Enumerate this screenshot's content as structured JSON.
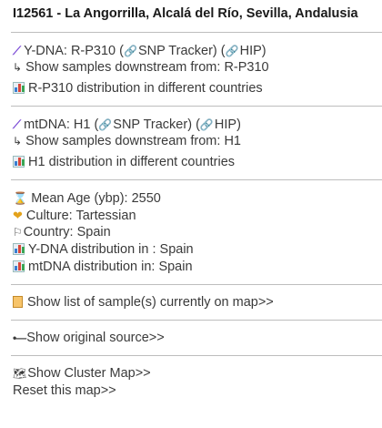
{
  "title": "I12561 - La Angorrilla, Alcalá del Río, Sevilla, Andalusia",
  "ydna": {
    "label": "Y-DNA: R-P310 (",
    "snp": "SNP Tracker",
    "mid": ") (",
    "hip": "HIP",
    "end": ")",
    "downstream": "Show samples downstream from: R-P310",
    "distribution": "R-P310 distribution in different countries"
  },
  "mtdna": {
    "label": "mtDNA: H1 (",
    "snp": "SNP Tracker",
    "mid": ") (",
    "hip": "HIP",
    "end": ")",
    "downstream": "Show samples downstream from: H1",
    "distribution": "H1 distribution in different countries"
  },
  "info": {
    "mean_age": "Mean Age (ybp): 2550",
    "culture": "Culture: Tartessian",
    "country": "Country: Spain",
    "ydna_dist": "Y-DNA distribution in : Spain",
    "mtdna_dist": "mtDNA distribution in: Spain"
  },
  "links": {
    "sample_list": "Show list of sample(s) currently on map>>",
    "original_source": "Show original source>>",
    "cluster_map": "Show Cluster Map>>",
    "reset": "Reset this map>>"
  },
  "icons": {
    "dna": "dna-icon",
    "arrow": "arrow-return-icon",
    "chart": "bar-chart-icon",
    "link": "link-icon",
    "hourglass": "hourglass-icon",
    "handshake": "handshake-icon",
    "flag": "flag-icon",
    "clipboard": "clipboard-icon",
    "dash": "dash-icon",
    "map": "world-map-icon"
  }
}
